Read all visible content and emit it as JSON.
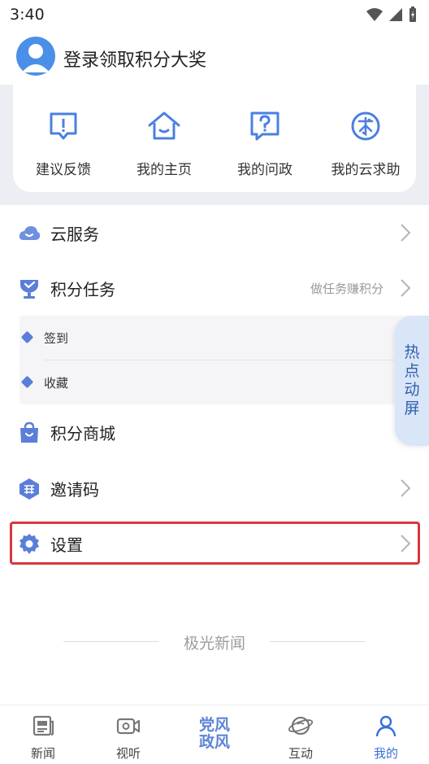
{
  "status_bar": {
    "time": "3:40"
  },
  "profile": {
    "login_prompt": "登录领取积分大奖"
  },
  "quick_actions": [
    {
      "label": "建议反馈",
      "icon": "feedback-icon"
    },
    {
      "label": "我的主页",
      "icon": "home-icon"
    },
    {
      "label": "我的问政",
      "icon": "question-icon"
    },
    {
      "label": "我的云求助",
      "icon": "help-request-icon"
    }
  ],
  "menu": {
    "cloud_service": "云服务",
    "points_tasks": "积分任务",
    "points_tasks_hint": "做任务赚积分",
    "sub_items": [
      "签到",
      "收藏"
    ],
    "points_mall": "积分商城",
    "invite_code": "邀请码",
    "settings": "设置"
  },
  "hot_tab": {
    "label": "热点动屏"
  },
  "footer": {
    "brand": "极光新闻"
  },
  "bottom_nav": [
    {
      "label": "新闻",
      "icon": "news-icon"
    },
    {
      "label": "视听",
      "icon": "video-icon"
    },
    {
      "label": "党风政风",
      "icon": "party-logo"
    },
    {
      "label": "互动",
      "icon": "interact-icon"
    },
    {
      "label": "我的",
      "icon": "profile-icon"
    }
  ],
  "colors": {
    "accent": "#3a6fd8",
    "highlight_border": "#d9363e",
    "menu_icon": "#5b7fd8"
  }
}
